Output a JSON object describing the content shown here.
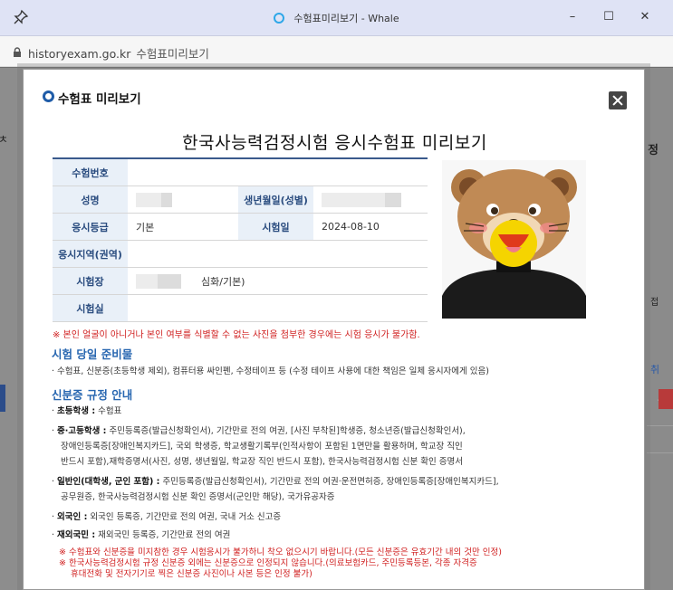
{
  "window": {
    "title": "수험표미리보기 - Whale",
    "minimize": "–",
    "maximize": "☐",
    "close": "✕"
  },
  "address": {
    "domain": "historyexam.go.kr",
    "page_title": "수험표미리보기"
  },
  "background_fragments": [
    "ㅊ",
    "정",
    "접",
    "취",
    "취"
  ],
  "modal": {
    "title": "수험표 미리보기",
    "doc_title": "한국사능력검정시험 응시수험표 미리보기",
    "labels": {
      "exam_number": "수험번호",
      "name": "성명",
      "birth_gender": "생년월일(성별)",
      "grade": "응시등급",
      "exam_date": "시험일",
      "region": "응시지역(권역)",
      "venue": "시험장",
      "room": "시험실"
    },
    "values": {
      "exam_number": "",
      "grade": "기본",
      "exam_date": "2024-08-10",
      "region": "",
      "venue_suffix": "심화/기본)",
      "room": ""
    },
    "warning": "※ 본인 얼굴이 아니거나 본인 여부를 식별할 수 없는 사진을 첨부한 경우에는 시험 응시가 불가함.",
    "prep_title": "시험 당일 준비물",
    "prep_item": "· 수험표, 신분증(초등학생 제외), 컴퓨터용 싸인펜, 수정테이프 등 (수정 테이프 사용에 대한 책임은 일체 응시자에게 있음)",
    "id_title": "신분증 규정 안내",
    "id_items": {
      "elem_label": "초등학생 :",
      "elem_text": " 수험표",
      "mid_label": "중·고등학생 :",
      "mid_text1": " 주민등록증(발급신청확인서), 기간만료 전의 여권, [사진 부착된]학생증, 청소년증(발급신청확인서),",
      "mid_text2": "장애인등록증[장애인복지카드], 국외 학생증, 학교생활기록부(인적사항이 포함된 1면만을 활용하며, 학교장 직인",
      "mid_text3": "반드시 포함),재학증명서(사진, 성명, 생년월일, 학교장 직인 반드시 포함), 한국사능력검정시험 신분 확인 증명서",
      "adult_label": "일반인(대학생, 군인 포함) :",
      "adult_text1": " 주민등록증(발급신청확인서), 기간만료 전의 여권·운전면허증, 장애인등록증[장애인복지카드],",
      "adult_text2": "공무원증, 한국사능력검정시험 신분 확인 증명서(군인만 해당), 국가유공자증",
      "foreign_label": "외국인 :",
      "foreign_text": " 외국인 등록증, 기간만료 전의 여권, 국내 거소 신고증",
      "overseas_label": "재외국민 :",
      "overseas_text": " 재외국민 등록증, 기간만료 전의 여권"
    },
    "notes": [
      "※ 수험표와 신분증을 미지참한 경우 시험응시가 불가하니 착오 없으시기 바랍니다.(모든 신분증은 유효기간 내의 것만 인정)",
      "※ 한국사능력검정시험 규정 신분증 외에는 신분증으로 인정되지 않습니다.(의료보험카드, 주민등록등본, 각종 자격증",
      "휴대전화 및 전자기기로 찍은 신분증 사진이나 사본 등은 인정 불가)"
    ]
  }
}
